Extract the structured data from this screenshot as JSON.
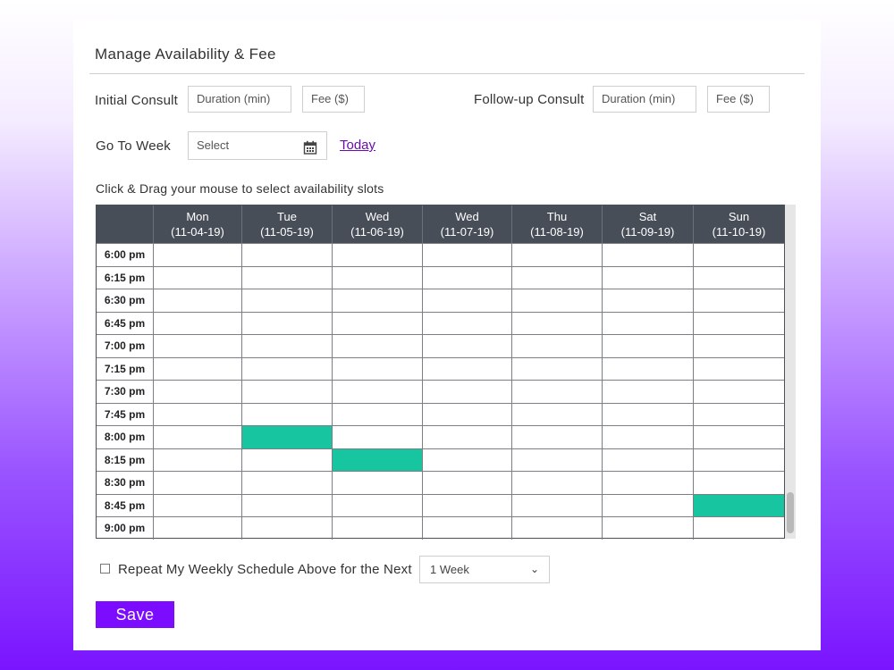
{
  "header": {
    "title": "Manage Availability & Fee"
  },
  "initial_consult": {
    "label": "Initial Consult",
    "duration_placeholder": "Duration (min)",
    "fee_placeholder": "Fee ($)"
  },
  "followup_consult": {
    "label": "Follow-up Consult",
    "duration_placeholder": "Duration (min)",
    "fee_placeholder": "Fee ($)"
  },
  "go_to_week": {
    "label": "Go To Week",
    "select_placeholder": "Select",
    "today_link": "Today",
    "calendar_icon": "calendar-icon"
  },
  "instructions": "Click & Drag your mouse to select availability slots",
  "schedule": {
    "days": [
      {
        "name": "Mon",
        "date": "(11-04-19)"
      },
      {
        "name": "Tue",
        "date": "(11-05-19)"
      },
      {
        "name": "Wed",
        "date": "(11-06-19)"
      },
      {
        "name": "Wed",
        "date": "(11-07-19)"
      },
      {
        "name": "Thu",
        "date": "(11-08-19)"
      },
      {
        "name": "Sat",
        "date": "(11-09-19)"
      },
      {
        "name": "Sun",
        "date": "(11-10-19)"
      }
    ],
    "times": [
      "6:00 pm",
      "6:15 pm",
      "6:30 pm",
      "6:45 pm",
      "7:00 pm",
      "7:15 pm",
      "7:30 pm",
      "7:45 pm",
      "8:00 pm",
      "8:15 pm",
      "8:30 pm",
      "8:45 pm",
      "9:00 pm"
    ],
    "selected_slots": [
      {
        "time": "8:00 pm",
        "day": "Tue"
      },
      {
        "time": "8:15 pm",
        "day": "Wed"
      },
      {
        "time": "8:45 pm",
        "day": "Sun"
      }
    ],
    "selected_color": "#17c5a0",
    "header_color": "#474e58"
  },
  "repeat": {
    "label": "Repeat My Weekly Schedule Above for the Next",
    "checked": false,
    "selected_option": "1 Week"
  },
  "save_label": "Save",
  "colors": {
    "accent": "#7b0cff",
    "link": "#6a0dad"
  }
}
